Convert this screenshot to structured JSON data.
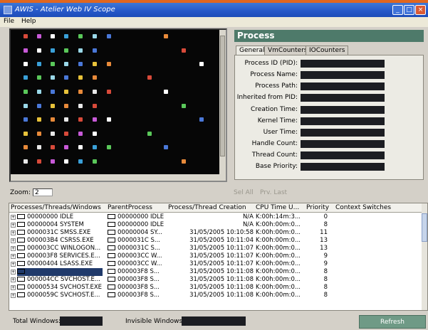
{
  "window": {
    "title": "AWIS - Atelier Web IV Scope",
    "controls": [
      "_",
      "□",
      "×"
    ]
  },
  "menu": [
    {
      "label": "File"
    },
    {
      "label": "Help"
    }
  ],
  "process_panel": {
    "title": "Process",
    "tabs": [
      {
        "label": "General",
        "active": true
      },
      {
        "label": "VmCounters"
      },
      {
        "label": "IOCounters"
      }
    ],
    "fields": [
      {
        "label": "Process ID (PID):",
        "value": ""
      },
      {
        "label": "Process Name:",
        "value": ""
      },
      {
        "label": "Process Path:",
        "value": ""
      },
      {
        "label": "Inherited from PID:",
        "value": ""
      },
      {
        "label": "Creation Time:",
        "value": ""
      },
      {
        "label": "Kernel Time:",
        "value": ""
      },
      {
        "label": "User Time:",
        "value": ""
      },
      {
        "label": "Handle Count:",
        "value": ""
      },
      {
        "label": "Thread Count:",
        "value": ""
      },
      {
        "label": "Base Priority:",
        "value": ""
      }
    ]
  },
  "zoom": {
    "label": "Zoom:",
    "value": "2",
    "select_all": "Sel All",
    "prev_last": "Prv. Last"
  },
  "table": {
    "columns": [
      "Processes/Threads/Windows",
      "ParentProcess",
      "Process/Thread Creation",
      "CPU Time U...",
      "Priority",
      "Context Switches"
    ],
    "rows": [
      {
        "name": "00000000 IDLE",
        "parent": "00000000 IDLE",
        "created": "N/A",
        "cpu": "K:00h:14m:3...",
        "priority": "0",
        "selected": false
      },
      {
        "name": "00000004 SYSTEM",
        "parent": "00000000 IDLE",
        "created": "N/A",
        "cpu": "K:00h:00m:0...",
        "priority": "8",
        "selected": false
      },
      {
        "name": "0000031C SMSS.EXE",
        "parent": "00000004 SY...",
        "created": "31/05/2005 10:10:58",
        "cpu": "K:00h:00m:0...",
        "priority": "11",
        "selected": false
      },
      {
        "name": "000003B4 CSRSS.EXE",
        "parent": "0000031C S...",
        "created": "31/05/2005 10:11:04",
        "cpu": "K:00h:00m:0...",
        "priority": "13",
        "selected": false
      },
      {
        "name": "000003CC WINLOGON...",
        "parent": "0000031C S...",
        "created": "31/05/2005 10:11:07",
        "cpu": "K:00h:00m:0...",
        "priority": "13",
        "selected": false
      },
      {
        "name": "000003F8 SERVICES.E...",
        "parent": "000003CC W...",
        "created": "31/05/2005 10:11:07",
        "cpu": "K:00h:00m:0...",
        "priority": "9",
        "selected": false
      },
      {
        "name": "00000404 LSASS.EXE",
        "parent": "000003CC W...",
        "created": "31/05/2005 10:11:07",
        "cpu": "K:00h:00m:0...",
        "priority": "9",
        "selected": false
      },
      {
        "name": "",
        "parent": "000003F8 S...",
        "created": "31/05/2005 10:11:08",
        "cpu": "K:00h:00m:0...",
        "priority": "8",
        "selected": true
      },
      {
        "name": "000004CC SVCHOST.E...",
        "parent": "000003F8 S...",
        "created": "31/05/2005 10:11:08",
        "cpu": "K:00h:00m:0...",
        "priority": "8",
        "selected": false
      },
      {
        "name": "00000534 SVCHOST.EXE",
        "parent": "000003F8 S...",
        "created": "31/05/2005 10:11:08",
        "cpu": "K:00h:00m:0...",
        "priority": "8",
        "selected": false
      },
      {
        "name": "0000059C SVCHOST.E...",
        "parent": "000003F8 S...",
        "created": "31/05/2005 10:11:08",
        "cpu": "K:00h:00m:0...",
        "priority": "8",
        "selected": false
      }
    ]
  },
  "status": {
    "total_label": "Total Windows:",
    "total_value": "",
    "invisible_label": "Invisible Windows:",
    "invisible_value": "",
    "refresh_label": "Refresh"
  }
}
